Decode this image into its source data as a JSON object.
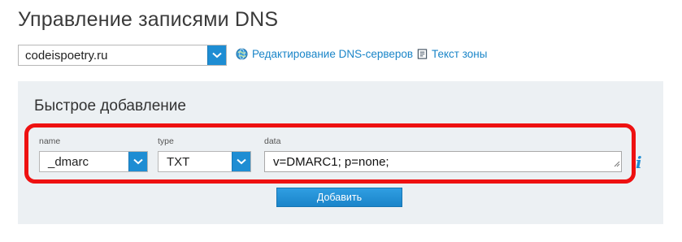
{
  "page": {
    "title": "Управление записями DNS"
  },
  "domain_selector": {
    "value": "codeispoetry.ru"
  },
  "links": {
    "dns_servers": {
      "label": "Редактирование DNS-серверов",
      "icon": "globe-icon"
    },
    "zone_text": {
      "label": "Текст зоны",
      "icon": "document-icon"
    }
  },
  "quick_add": {
    "title": "Быстрое добавление",
    "fields": {
      "name": {
        "label": "name",
        "value": "_dmarc"
      },
      "type": {
        "label": "type",
        "value": "TXT"
      },
      "data": {
        "label": "data",
        "value": "v=DMARC1; p=none;"
      }
    },
    "info_icon": "i",
    "add_button": "Добавить"
  },
  "colors": {
    "accent": "#1e8dd3",
    "link": "#1a85c8",
    "panel_bg": "#ecf0f3",
    "highlight": "#ee1111"
  }
}
